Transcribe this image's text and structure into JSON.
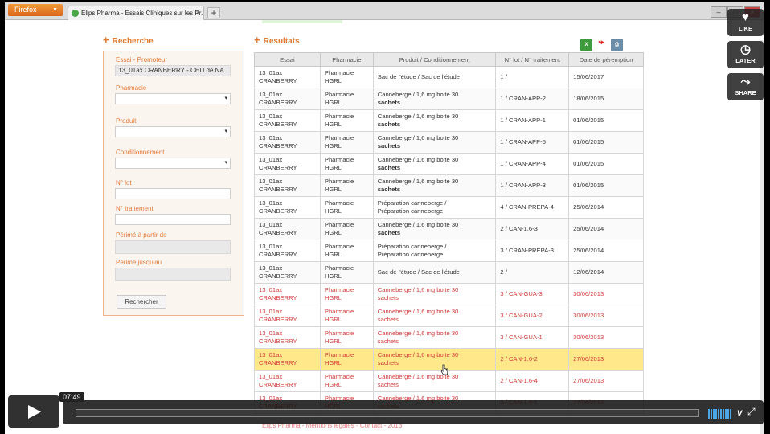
{
  "browser": {
    "menu_button": "Firefox",
    "tab_title": "Elips Pharma - Essais Cliniques sur les Pr...",
    "new_tab": "+"
  },
  "search": {
    "title": "Recherche",
    "fields": [
      {
        "label": "Essai - Promoteur",
        "value": "13_01ax CRANBERRY - CHU de NA"
      },
      {
        "label": "Pharmacie",
        "value": ""
      },
      {
        "label": "Produit",
        "value": ""
      },
      {
        "label": "Conditionnement",
        "value": ""
      },
      {
        "label": "N° lot",
        "value": ""
      },
      {
        "label": "N° traitement",
        "value": ""
      },
      {
        "label": "Périmé à partir de",
        "value": ""
      },
      {
        "label": "Périmé jusqu'au",
        "value": ""
      }
    ],
    "button": "Rechercher"
  },
  "results": {
    "title": "Resultats",
    "exports": [
      {
        "name": "excel-icon",
        "glyph": "X"
      },
      {
        "name": "pdf-icon",
        "glyph": "⌘"
      },
      {
        "name": "print-icon",
        "glyph": "⎙"
      }
    ],
    "columns": [
      "Essai",
      "Pharmacie",
      "Produit / Conditionnement",
      "N° lot / N° traitement",
      "Date de péremption"
    ],
    "rows": [
      {
        "essai1": "13_01ax",
        "essai2": "CRANBERRY",
        "ph1": "Pharmacie",
        "ph2": "HGRL",
        "prod1": "Sac de l'étude / Sac de l'étude",
        "prod2": "",
        "lot": "1 /",
        "date": "15/06/2017",
        "state": "normal"
      },
      {
        "essai1": "13_01ax",
        "essai2": "CRANBERRY",
        "ph1": "Pharmacie",
        "ph2": "HGRL",
        "prod1": "Canneberge / 1,6 mg boite 30",
        "prod2": "sachets",
        "lot": "1 / CRAN-APP-2",
        "date": "18/06/2015",
        "state": "normal"
      },
      {
        "essai1": "13_01ax",
        "essai2": "CRANBERRY",
        "ph1": "Pharmacie",
        "ph2": "HGRL",
        "prod1": "Canneberge / 1,6 mg boite 30",
        "prod2": "sachets",
        "lot": "1 / CRAN-APP-1",
        "date": "01/06/2015",
        "state": "normal"
      },
      {
        "essai1": "13_01ax",
        "essai2": "CRANBERRY",
        "ph1": "Pharmacie",
        "ph2": "HGRL",
        "prod1": "Canneberge / 1,6 mg boite 30",
        "prod2": "sachets",
        "lot": "1 / CRAN-APP-5",
        "date": "01/06/2015",
        "state": "normal"
      },
      {
        "essai1": "13_01ax",
        "essai2": "CRANBERRY",
        "ph1": "Pharmacie",
        "ph2": "HGRL",
        "prod1": "Canneberge / 1,6 mg boite 30",
        "prod2": "sachets",
        "lot": "1 / CRAN-APP-4",
        "date": "01/06/2015",
        "state": "normal"
      },
      {
        "essai1": "13_01ax",
        "essai2": "CRANBERRY",
        "ph1": "Pharmacie",
        "ph2": "HGRL",
        "prod1": "Canneberge / 1,6 mg boite 30",
        "prod2": "sachets",
        "lot": "1 / CRAN-APP-3",
        "date": "01/06/2015",
        "state": "normal"
      },
      {
        "essai1": "13_01ax",
        "essai2": "CRANBERRY",
        "ph1": "Pharmacie",
        "ph2": "HGRL",
        "prod1": "Préparation canneberge /",
        "prod2": "Préparation canneberge",
        "lot": "4 / CRAN-PREPA-4",
        "date": "25/06/2014",
        "state": "normal"
      },
      {
        "essai1": "13_01ax",
        "essai2": "CRANBERRY",
        "ph1": "Pharmacie",
        "ph2": "HGRL",
        "prod1": "Canneberge / 1,6 mg boite 30",
        "prod2": "sachets",
        "lot": "2 / CAN-1.6-3",
        "date": "25/06/2014",
        "state": "normal"
      },
      {
        "essai1": "13_01ax",
        "essai2": "CRANBERRY",
        "ph1": "Pharmacie",
        "ph2": "HGRL",
        "prod1": "Préparation canneberge /",
        "prod2": "Préparation canneberge",
        "lot": "3 / CRAN-PREPA-3",
        "date": "25/06/2014",
        "state": "normal"
      },
      {
        "essai1": "13_01ax",
        "essai2": "CRANBERRY",
        "ph1": "Pharmacie",
        "ph2": "HGRL",
        "prod1": "Sac de l'étude / Sac de l'étude",
        "prod2": "",
        "lot": "2 /",
        "date": "12/06/2014",
        "state": "normal"
      },
      {
        "essai1": "13_01ax",
        "essai2": "CRANBERRY",
        "ph1": "Pharmacie",
        "ph2": "HGRL",
        "prod1": "Canneberge / 1,6 mg boite 30",
        "prod2": "sachets",
        "lot": "3 / CAN-GUA-3",
        "date": "30/06/2013",
        "state": "expired"
      },
      {
        "essai1": "13_01ax",
        "essai2": "CRANBERRY",
        "ph1": "Pharmacie",
        "ph2": "HGRL",
        "prod1": "Canneberge / 1,6 mg boite 30",
        "prod2": "sachets",
        "lot": "3 / CAN-GUA-2",
        "date": "30/06/2013",
        "state": "expired"
      },
      {
        "essai1": "13_01ax",
        "essai2": "CRANBERRY",
        "ph1": "Pharmacie",
        "ph2": "HGRL",
        "prod1": "Canneberge / 1,6 mg boite 30",
        "prod2": "sachets",
        "lot": "3 / CAN-GUA-1",
        "date": "30/06/2013",
        "state": "expired"
      },
      {
        "essai1": "13_01ax",
        "essai2": "CRANBERRY",
        "ph1": "Pharmacie",
        "ph2": "HGRL",
        "prod1": "Canneberge / 1,6 mg boite 30",
        "prod2": "sachets",
        "lot": "2 / CAN-1.6-2",
        "date": "27/06/2013",
        "state": "highlight"
      },
      {
        "essai1": "13_01ax",
        "essai2": "CRANBERRY",
        "ph1": "Pharmacie",
        "ph2": "HGRL",
        "prod1": "Canneberge / 1,6 mg boite 30",
        "prod2": "sachets",
        "lot": "2 / CAN-1.6-4",
        "date": "27/06/2013",
        "state": "expired"
      },
      {
        "essai1": "13_01ax",
        "essai2": "CRANBERRY",
        "ph1": "Pharmacie",
        "ph2": "HGRL",
        "prod1": "Canneberge / 1,6 mg boite 30",
        "prod2": "sachets",
        "lot": "2 / CAN-1.6-1",
        "date": "27/06/2013",
        "state": "expired"
      }
    ]
  },
  "footer": "Elips Pharma - Mentions légales - Contact - 2013",
  "player": {
    "like": "LIKE",
    "later": "LATER",
    "share": "SHARE",
    "time": "07:49",
    "progress": 0.0,
    "accent": "#4da5e3"
  }
}
